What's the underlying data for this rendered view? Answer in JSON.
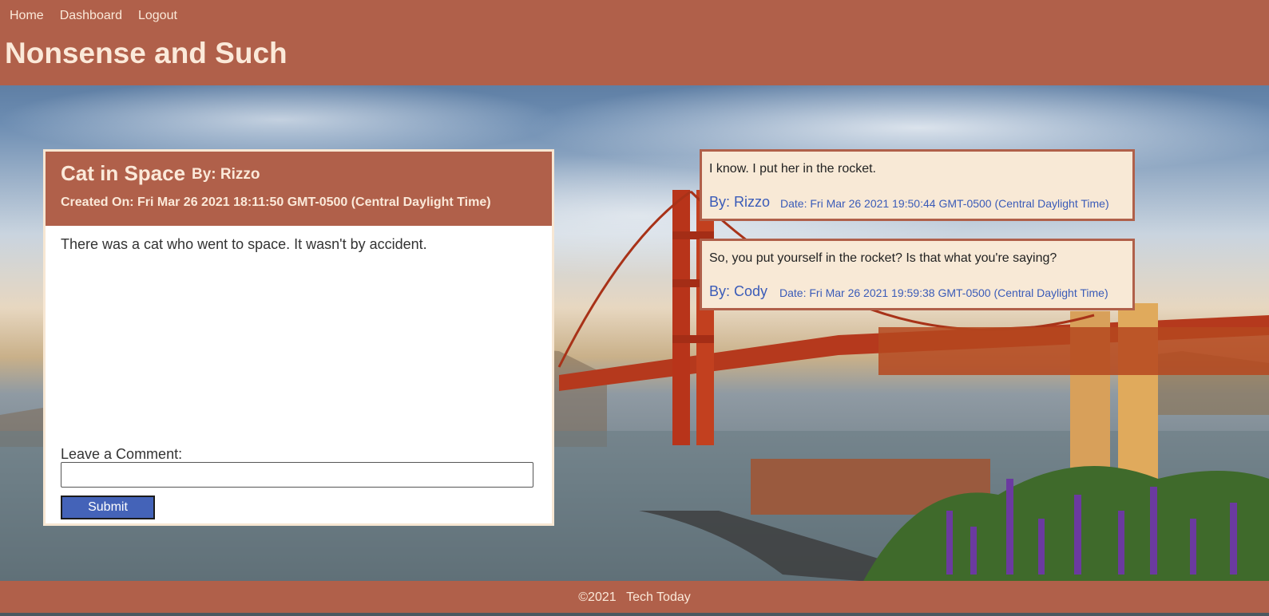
{
  "nav": {
    "links": [
      "Home",
      "Dashboard",
      "Logout"
    ]
  },
  "site": {
    "title": "Nonsense and Such"
  },
  "post": {
    "title": "Cat in Space",
    "author": "By: Rizzo",
    "created": "Created On: Fri Mar 26 2021 18:11:50 GMT-0500 (Central Daylight Time)",
    "body": "There was a cat who went to space. It wasn't by accident."
  },
  "comment_form": {
    "label": "Leave a Comment:",
    "value": "",
    "submit_label": "Submit"
  },
  "comments": [
    {
      "text": "I know. I put her in the rocket.",
      "by": "By: Rizzo",
      "date": "Date: Fri Mar 26 2021 19:50:44 GMT-0500 (Central Daylight Time)"
    },
    {
      "text": "So, you put yourself in the rocket? Is that what you're saying?",
      "by": "By: Cody",
      "date": "Date: Fri Mar 26 2021 19:59:38 GMT-0500 (Central Daylight Time)"
    }
  ],
  "footer": {
    "copyright": "©2021",
    "brand": "Tech Today"
  },
  "colors": {
    "header": "#b0604a",
    "header_text": "#fbe9d9",
    "comment_bg": "#f8e9d6",
    "link_blue": "#3a5bb8",
    "submit_bg": "#4463b8"
  }
}
